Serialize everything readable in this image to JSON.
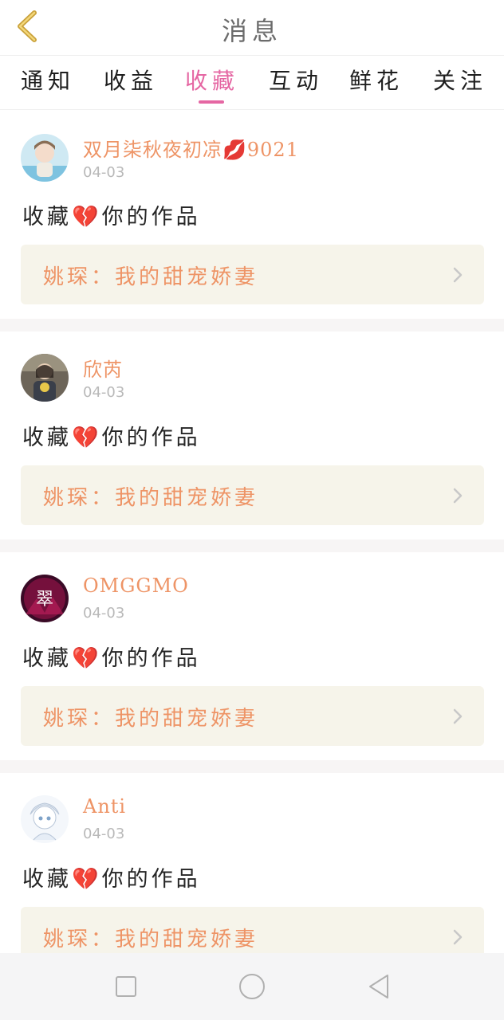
{
  "header": {
    "title": "消息"
  },
  "tabs": [
    {
      "label": "通知"
    },
    {
      "label": "收益"
    },
    {
      "label": "收藏"
    },
    {
      "label": "互动"
    },
    {
      "label": "鲜花"
    },
    {
      "label": "关注"
    }
  ],
  "active_tab": "收藏",
  "notifications": [
    {
      "username": "双月柒秋夜初凉💋9021",
      "date": "04-03",
      "action": "收藏💔你的作品",
      "work_title": "姚琛：我的甜宠娇妻"
    },
    {
      "username": "欣芮",
      "date": "04-03",
      "action": "收藏💔你的作品",
      "work_title": "姚琛：我的甜宠娇妻"
    },
    {
      "username": "OMGGMO",
      "date": "04-03",
      "action": "收藏💔你的作品",
      "work_title": "姚琛：我的甜宠娇妻"
    },
    {
      "username": "Anti",
      "date": "04-03",
      "action": "收藏💔你的作品",
      "work_title": "姚琛：我的甜宠娇妻"
    }
  ],
  "avatars": {
    "a3_text": "翠"
  },
  "colors": {
    "accent": "#e567a3",
    "username": "#ee9466",
    "link_bg": "#f6f4ea"
  }
}
